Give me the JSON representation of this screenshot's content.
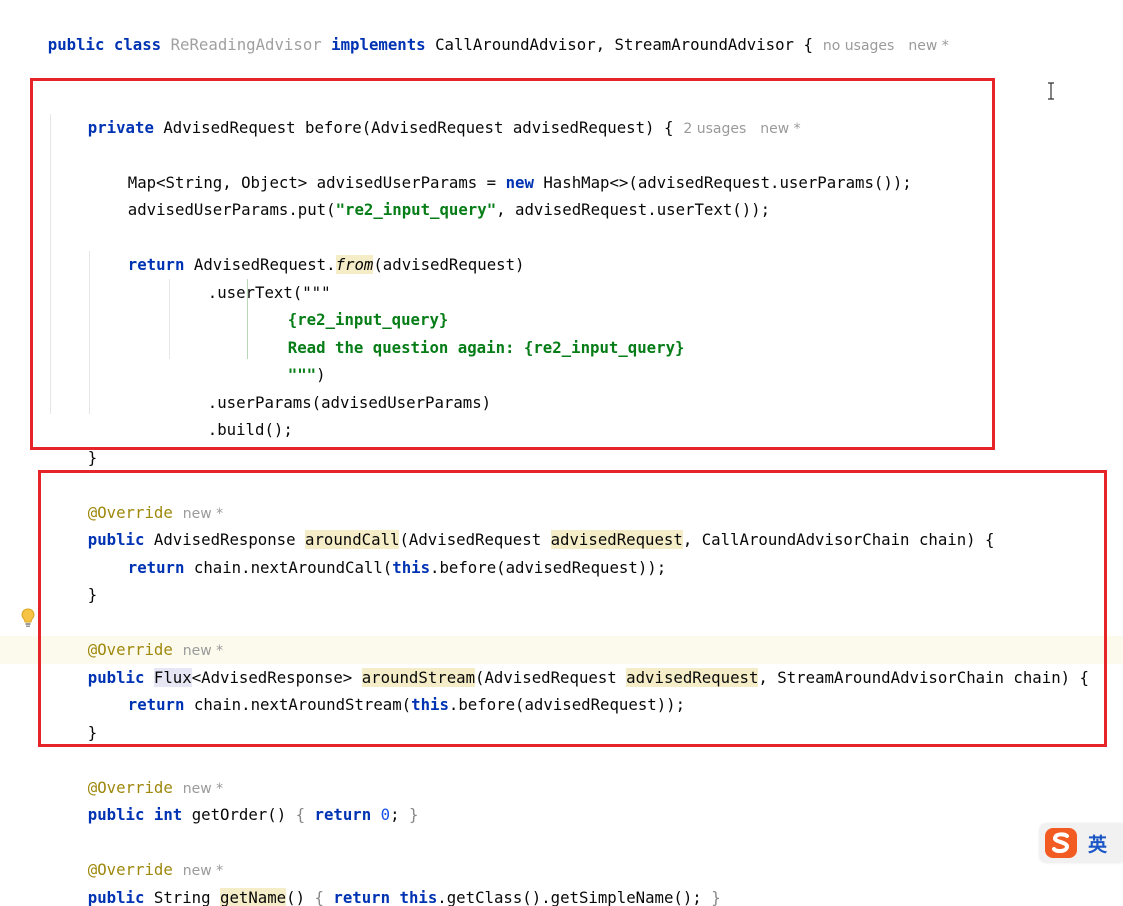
{
  "editor": {
    "class_decl": {
      "kw_public": "public",
      "kw_class": "class",
      "class_name": "ReReadingAdvisor",
      "kw_implements": "implements",
      "iface1": "CallAroundAdvisor,",
      "iface2": "StreamAroundAdvisor {",
      "usages": "no usages",
      "new_hint": "new *"
    },
    "before_method": {
      "signature": {
        "kw_private": "private",
        "return_type": "AdvisedRequest",
        "rest": "before(AdvisedRequest advisedRequest) {",
        "usages": "2 usages",
        "new_hint": "new *"
      },
      "line_map": {
        "prefix": "Map<String, Object> advisedUserParams = ",
        "kw_new": "new",
        "suffix": " HashMap<>(advisedRequest.userParams());"
      },
      "line_put": {
        "prefix": "advisedUserParams.put(",
        "string": "\"re2_input_query\"",
        "suffix": ", advisedRequest.userText());"
      },
      "line_return": {
        "kw_return": "return",
        "prefix": " AdvisedRequest.",
        "method": "from",
        "suffix": "(advisedRequest)"
      },
      "line_usertext": ".userText(\"\"\"",
      "text_block_1": "{re2_input_query}",
      "text_block_2": "Read the question again: {re2_input_query}",
      "text_block_end_quotes": "\"\"\"",
      "text_block_end_paren": ")",
      "line_userparams": ".userParams(advisedUserParams)",
      "line_build": ".build();",
      "close_brace": "}"
    },
    "around_call": {
      "annotation": "@Override",
      "new_hint": "new *",
      "kw_public": "public",
      "return_type": " AdvisedResponse ",
      "method": "aroundCall",
      "param_open": "(AdvisedRequest ",
      "param_name": "advisedRequest",
      "param_rest": ", CallAroundAdvisorChain chain) {",
      "body_kw_return": "return",
      "body_prefix": " chain.nextAroundCall(",
      "body_kw_this": "this",
      "body_suffix": ".before(advisedRequest));",
      "close_brace": "}"
    },
    "around_stream": {
      "annotation": "@Override",
      "new_hint": "new *",
      "kw_public": "public",
      "flux": "Flux",
      "return_type_rest": "<AdvisedResponse> ",
      "method": "aroundStream",
      "param_open": "(AdvisedRequest ",
      "param_name": "advisedRequest",
      "param_rest": ", StreamAroundAdvisorChain chain) {",
      "body_kw_return": "return",
      "body_prefix": " chain.nextAroundStream(",
      "body_kw_this": "this",
      "body_suffix": ".before(advisedRequest));",
      "close_brace": "}"
    },
    "get_order": {
      "annotation": "@Override",
      "new_hint": "new *",
      "kw_public": "public",
      "kw_int": "int",
      "method_sig": " getOrder() ",
      "brace_open": "{",
      "kw_return": "return",
      "number": "0",
      "semi": ";",
      "brace_close": "}"
    },
    "get_name": {
      "annotation": "@Override",
      "new_hint": "new *",
      "kw_public": "public",
      "return_type": " String ",
      "method": "getName",
      "parens": "() ",
      "brace_open": "{",
      "kw_return": "return",
      "kw_this": "this",
      "body_suffix": ".getClass().getSimpleName();",
      "brace_close": "}"
    },
    "class_close": "}"
  },
  "ime": {
    "mode_label": "英"
  },
  "colors": {
    "keyword": "#0033b3",
    "string": "#067d17",
    "annotation": "#9e880d",
    "number": "#1750eb",
    "highlight_box": "#e5252a",
    "usage_highlight": "#f5edc8"
  }
}
